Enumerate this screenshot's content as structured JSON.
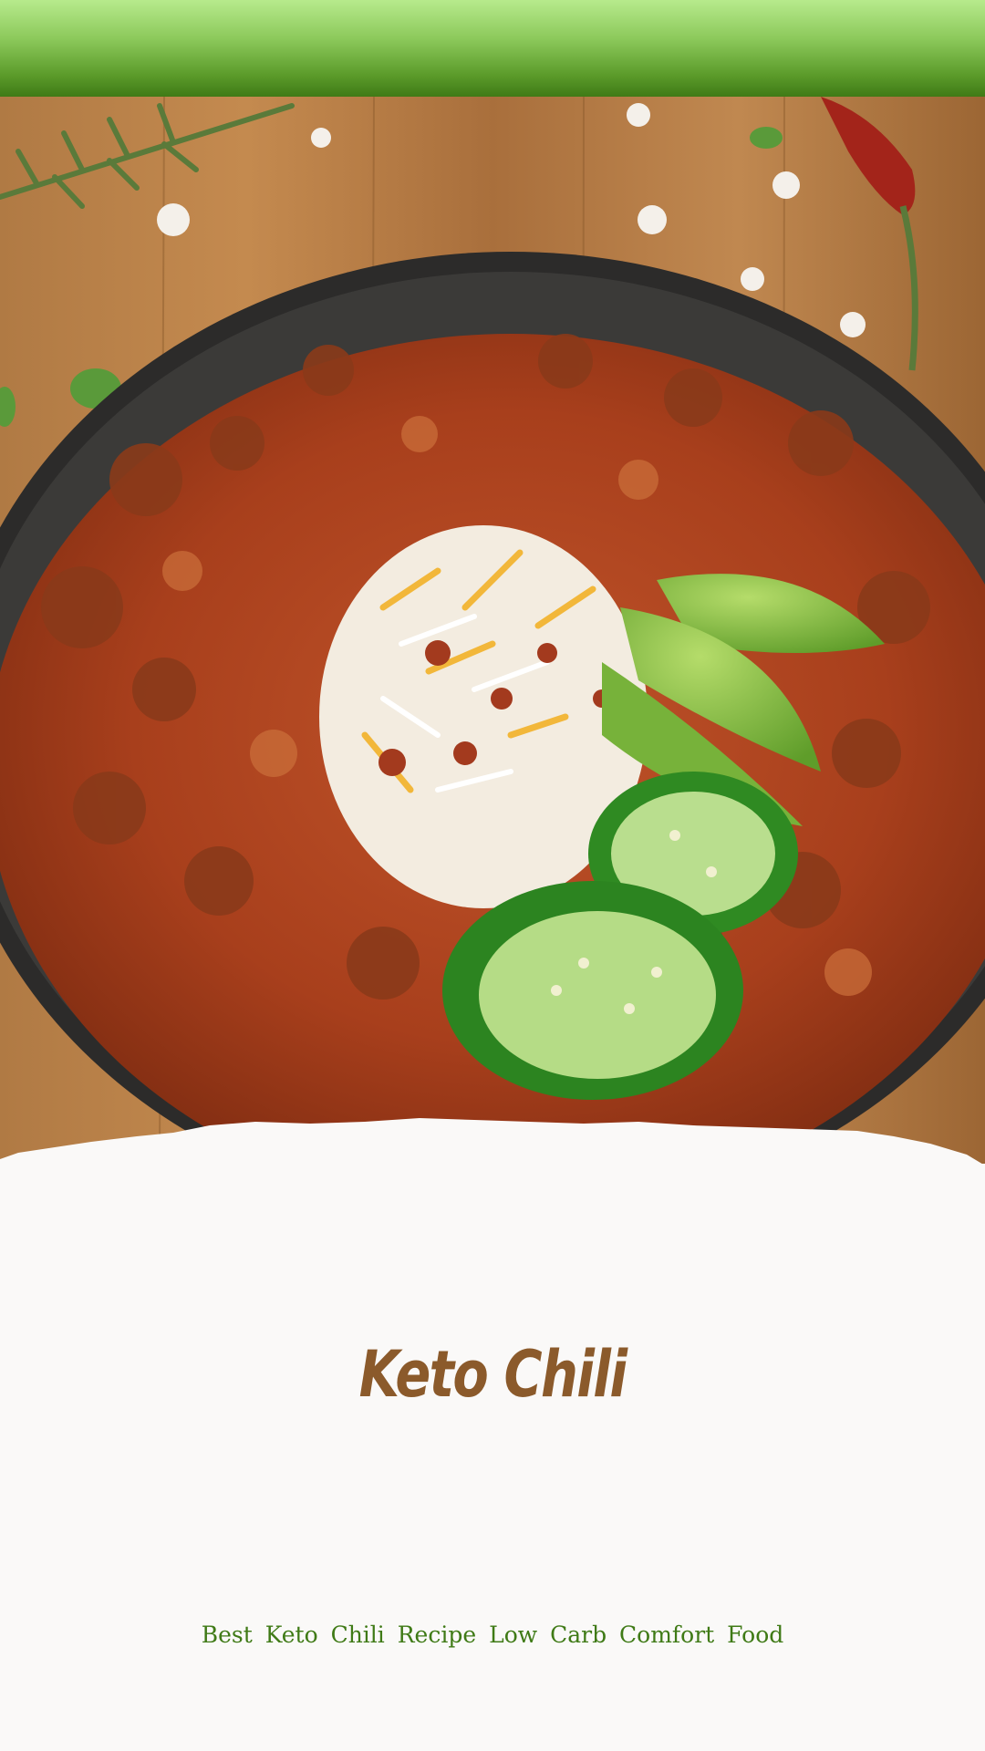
{
  "header": {
    "bar_color_top": "#b7ea8c",
    "bar_color_bottom": "#3f7a16"
  },
  "hero": {
    "image_name": "keto-chili-bowl-photo"
  },
  "recipe": {
    "title": "Keto Chili",
    "subtitle": "Best Keto Chili Recipe Low Carb Comfort Food",
    "title_color": "#8b5a2b",
    "subtitle_color": "#3f7a16"
  }
}
